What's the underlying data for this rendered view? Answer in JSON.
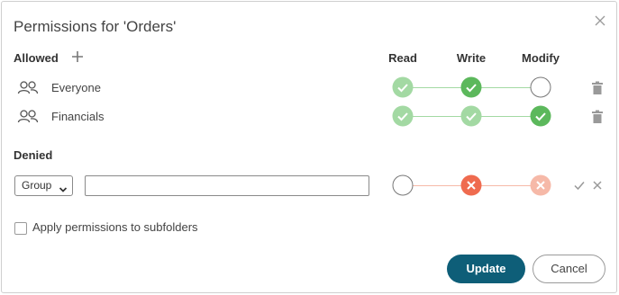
{
  "dialog": {
    "title": "Permissions for 'Orders'",
    "close_icon": "close-icon"
  },
  "allowed": {
    "label": "Allowed",
    "add_icon": "plus-icon",
    "columns": [
      "Read",
      "Write",
      "Modify"
    ],
    "rows": [
      {
        "name": "Everyone",
        "icon": "group-icon",
        "read": "granted-light",
        "write": "granted",
        "modify": "empty"
      },
      {
        "name": "Financials",
        "icon": "group-icon",
        "read": "granted-light",
        "write": "granted-light",
        "modify": "granted"
      }
    ]
  },
  "denied": {
    "label": "Denied",
    "type_select": {
      "selected": "Group"
    },
    "name_input": {
      "value": "",
      "placeholder": ""
    },
    "row": {
      "read": "empty",
      "write": "denied",
      "modify": "denied-light"
    },
    "confirm_icon": "check-icon",
    "clear_icon": "close-icon"
  },
  "options": {
    "apply_subfolders_label": "Apply permissions to subfolders",
    "apply_subfolders_checked": false
  },
  "footer": {
    "update_label": "Update",
    "cancel_label": "Cancel"
  },
  "colors": {
    "granted": "#5cb85c",
    "granted_light": "#a3d9a3",
    "denied": "#ef6b4f",
    "denied_light": "#f6b9a8",
    "primary_button": "#0e5e78"
  }
}
